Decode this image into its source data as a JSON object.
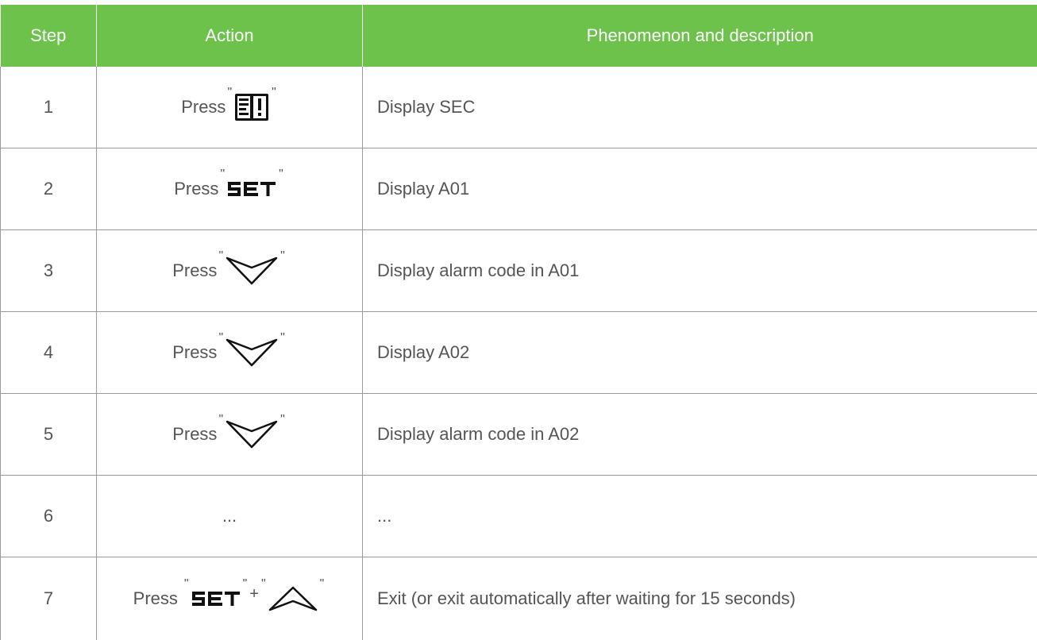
{
  "table": {
    "headers": {
      "step": "Step",
      "action": "Action",
      "description": "Phenomenon and description"
    },
    "rows": [
      {
        "step": "1",
        "action": {
          "prefix": "Press",
          "quote": "\"",
          "key": "manual-alarm-book-icon"
        },
        "description": "Display SEC"
      },
      {
        "step": "2",
        "action": {
          "prefix": "Press",
          "quote": "\"",
          "key": "SET"
        },
        "description": "Display A01"
      },
      {
        "step": "3",
        "action": {
          "prefix": "Press",
          "quote": "\"",
          "key": "down-arrow-icon"
        },
        "description": "Display alarm code in  A01"
      },
      {
        "step": "4",
        "action": {
          "prefix": "Press",
          "quote": "\"",
          "key": "down-arrow-icon"
        },
        "description": "Display A02"
      },
      {
        "step": "5",
        "action": {
          "prefix": "Press",
          "quote": "\"",
          "key": "down-arrow-icon"
        },
        "description": "Display alarm code in  A02"
      },
      {
        "step": "6",
        "action": {
          "text": "..."
        },
        "description": "..."
      },
      {
        "step": "7",
        "action": {
          "prefix": "Press",
          "quote": "\"",
          "key": "SET",
          "plus": "+",
          "key2": "up-arrow-icon"
        },
        "description": "Exit (or exit automatically after waiting for 15 seconds)"
      }
    ]
  },
  "colors": {
    "header_bg": "#6cc24a",
    "header_text": "#ffffff",
    "body_text": "#555555",
    "rule": "#9a9a9a"
  }
}
